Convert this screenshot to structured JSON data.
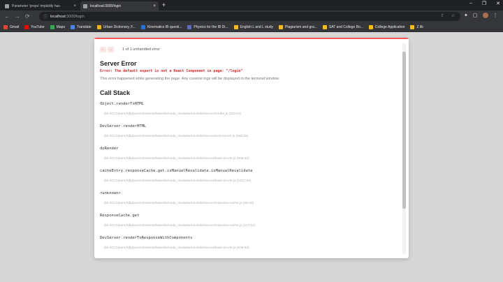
{
  "browser": {
    "tabs": [
      {
        "title": "Parameter 'props' implicitly has",
        "close": "×"
      },
      {
        "title": "localhost:3000/login",
        "close": "×"
      }
    ],
    "new_tab": "+",
    "window_controls": {
      "minimize": "–",
      "maximize": "❐",
      "close": "✕"
    },
    "nav": {
      "back": "←",
      "forward": "→",
      "reload": "⟳"
    },
    "address": {
      "lock": "ⓘ",
      "host": "localhost",
      "rest": ":3000/login"
    },
    "omni_icons": [
      "⇪",
      "☆"
    ],
    "toolbar_icons": [
      "✦",
      "▢",
      "⋮"
    ],
    "bookmarks": [
      {
        "label": "Gmail",
        "color": "#ea4335"
      },
      {
        "label": "YouTube",
        "color": "#ff0000"
      },
      {
        "label": "Maps",
        "color": "#34a853"
      },
      {
        "label": "Translate",
        "color": "#4285f4"
      },
      {
        "label": "Urban Dictionary, F...",
        "color": "#f4b400"
      },
      {
        "label": "Kinematics IB questi...",
        "color": "#1a73e8"
      },
      {
        "label": "Physics for the IB Di...",
        "color": "#5c6bc0"
      },
      {
        "label": "English L and L study",
        "color": "#fbbc04"
      },
      {
        "label": "Plagiarism and gra...",
        "color": "#fbbc04"
      },
      {
        "label": "SAT and College Bo...",
        "color": "#fbbc04"
      },
      {
        "label": "College Application",
        "color": "#fbbc04"
      },
      {
        "label": "Z lib",
        "color": "#fbbc04"
      }
    ]
  },
  "error_overlay": {
    "prev": "←",
    "next": "→",
    "counter": "1 of 1 unhandled error",
    "title": "Server Error",
    "message": "Error: The default export is not a React Component in page: \"/login\"",
    "description": "This error happened while generating the page. Any console logs will be displayed in the terminal window.",
    "call_stack_title": "Call Stack",
    "frames": [
      {
        "fn": "Object.renderToHTML",
        "path": "file:///C:/Users/Siftaboo%20Hanse/Mansito/node_modules/next/dist/server/render.js (313:19)"
      },
      {
        "fn": "DevServer.renderHTML",
        "path": "file:///C:/Users/Siftaboo%20Hanse/Mansito/node_modules/next/dist/server/next-server.js (825:29)"
      },
      {
        "fn": "doRender",
        "path": "file:///C:/Users/Siftaboo%20Hanse/Mansito/node_modules/next/dist/server/base-server.js (908:40)"
      },
      {
        "fn": "cacheEntry.responseCache.get.isManualRevalidate.isManualRevalidate",
        "path": "file:///C:/Users/Siftaboo%20Hanse/Mansito/node_modules/next/dist/server/base-server.js (1017:34)"
      },
      {
        "fn": "<unknown>",
        "path": "file:///C:/Users/Siftaboo%20Hanse/Mansito/node_modules/next/dist/server/response-cache.js (69:40)"
      },
      {
        "fn": "ResponseCache.get",
        "path": "file:///C:/Users/Siftaboo%20Hanse/Mansito/node_modules/next/dist/server/response-cache.js (117:11)"
      },
      {
        "fn": "DevServer.renderToResponseWithComponents",
        "path": "file:///C:/Users/Siftaboo%20Hanse/Mansito/node_modules/next/dist/server/base-server.js (939:53)"
      }
    ]
  }
}
